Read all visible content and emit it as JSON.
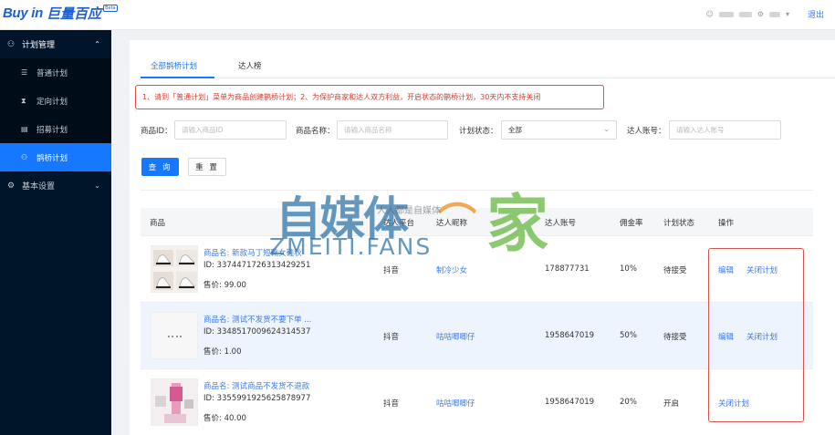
{
  "header": {
    "logo_en": "Buy in",
    "logo_cn": "巨量百应",
    "logo_tag": "Beta",
    "user_prefix": "",
    "logout": "退出"
  },
  "sidebar": {
    "group_plan": "计划管理",
    "items": [
      {
        "label": "普通计划",
        "icon": "list-icon"
      },
      {
        "label": "定向计划",
        "icon": "hourglass-icon"
      },
      {
        "label": "招募计划",
        "icon": "document-icon"
      },
      {
        "label": "鹊桥计划",
        "icon": "people-icon",
        "active": true
      }
    ],
    "group_settings": "基本设置"
  },
  "tabs": [
    "全部鹊桥计划",
    "达人榜"
  ],
  "notice": "1、请到「普通计划」菜单为商品创建鹊桥计划；2、为保护商家和达人双方利益，开启状态的鹊桥计划，30天内不支持关闭",
  "filters": {
    "product_id_label": "商品ID：",
    "product_id_placeholder": "请输入商品ID",
    "product_name_label": "商品名称：",
    "product_name_placeholder": "请输入商品名称",
    "status_label": "计划状态：",
    "status_value": "全部",
    "account_label": "达人账号：",
    "account_placeholder": "请输入达人账号"
  },
  "buttons": {
    "query": "查 询",
    "reset": "重 置"
  },
  "table": {
    "columns": [
      "商品",
      "达人平台",
      "达人昵称",
      "达人账号",
      "佣金率",
      "计划状态",
      "操作"
    ],
    "rows": [
      {
        "name": "商品名: 新款马丁短靴女鞋秋",
        "id": "ID: 3374471726313429251",
        "price": "售价:   99.00",
        "platform": "抖音",
        "nickname": "制冷少女",
        "account": "178877731",
        "rate": "10%",
        "status": "待接受",
        "actions": [
          "编辑",
          "关闭计划"
        ]
      },
      {
        "name": "商品名: 测试不发货不要下单 ...",
        "id": "ID: 3348517009624314537",
        "price": "售价:   1.00",
        "platform": "抖音",
        "nickname": "咕咕唧唧仔",
        "account": "1958647019",
        "rate": "50%",
        "status": "待接受",
        "actions": [
          "编辑",
          "关闭计划"
        ]
      },
      {
        "name": "商品名: 测试商品不发货不退款",
        "id": "ID: 3355991925625878977",
        "price": "售价:   40.00",
        "platform": "抖音",
        "nickname": "咕咕唧唧仔",
        "account": "1958647019",
        "rate": "20%",
        "status": "开启",
        "actions": [
          "关闭计划"
        ]
      }
    ]
  },
  "watermark": {
    "cn_a": "自媒体",
    "cn_b": "家",
    "en": "ZMEITI.FANS",
    "small": "人人都是自媒体"
  },
  "colors": {
    "primary": "#1677ff",
    "sidebar": "#001529",
    "notice": "#d53c2e"
  }
}
